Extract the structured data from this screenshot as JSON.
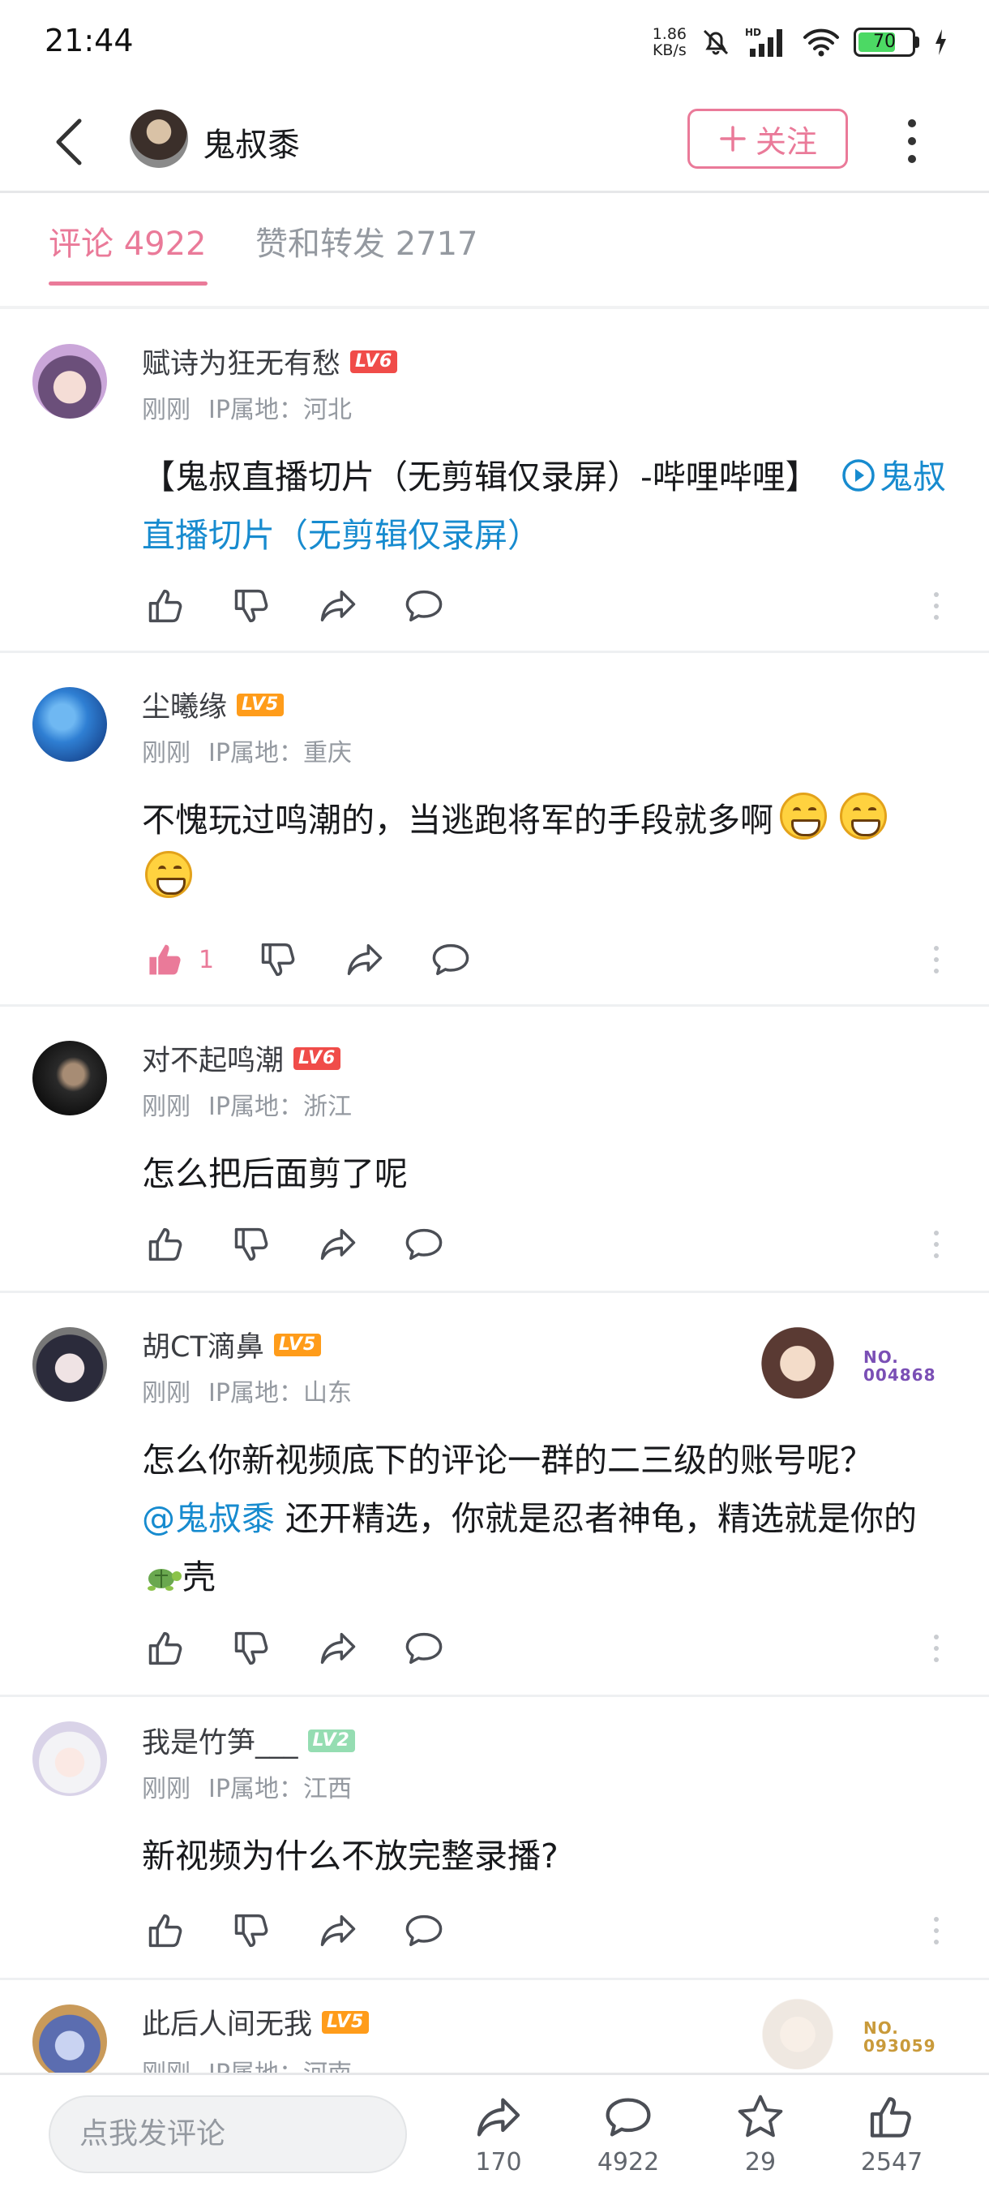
{
  "status_bar": {
    "time": "21:44",
    "net_speed_value": "1.86",
    "net_speed_unit": "KB/s",
    "battery": "70",
    "battery_fraction": 0.7
  },
  "header": {
    "username": "鬼叔黍",
    "follow_label": "关注"
  },
  "tabs": [
    {
      "label": "评论 4922",
      "active": true
    },
    {
      "label": "赞和转发 2717",
      "active": false
    }
  ],
  "comments": [
    {
      "username": "赋诗为狂无有愁",
      "level": "LV6",
      "time": "刚刚",
      "ip": "IP属地：河北",
      "text_plain": "【鬼叔直播切片（无剪辑仅录屏）-哔哩哔哩】",
      "text_link": "鬼叔直播切片（无剪辑仅录屏）",
      "likes": ""
    },
    {
      "username": "尘曦缘",
      "level": "LV5",
      "time": "刚刚",
      "ip": "IP属地：重庆",
      "text_plain": "不愧玩过鸣潮的，当逃跑将军的手段就多啊",
      "likes": "1"
    },
    {
      "username": "对不起鸣潮",
      "level": "LV6",
      "time": "刚刚",
      "ip": "IP属地：浙江",
      "text_plain": "怎么把后面剪了呢",
      "likes": ""
    },
    {
      "username": "胡CT滴鼻",
      "level": "LV5",
      "time": "刚刚",
      "ip": "IP属地：山东",
      "badge_no": "NO.",
      "badge_num": "004868",
      "text_part1": "怎么你新视频底下的评论一群的二三级的账号呢？",
      "text_mention": "@鬼叔黍",
      "text_part2": " 还开精选，你就是忍者神龟，精选就是你的",
      "text_part3": "壳",
      "likes": ""
    },
    {
      "username": "我是竹笋___",
      "level": "LV2",
      "time": "刚刚",
      "ip": "IP属地：江西",
      "text_plain": "新视频为什么不放完整录播?",
      "likes": ""
    },
    {
      "username": "此后人间无我",
      "level": "LV5",
      "time": "刚刚",
      "ip": "IP属地：河南",
      "badge_no": "NO.",
      "badge_num": "093059"
    }
  ],
  "bottom_bar": {
    "input_placeholder": "点我发评论",
    "share_count": "170",
    "comment_count": "4922",
    "favorite_count": "29",
    "like_count": "2547"
  },
  "colors": {
    "accent": "#ea7a99",
    "link": "#178bcf",
    "lv6": "#f04c49",
    "lv5": "#ff9c1a",
    "lv2": "#95ddb2"
  }
}
